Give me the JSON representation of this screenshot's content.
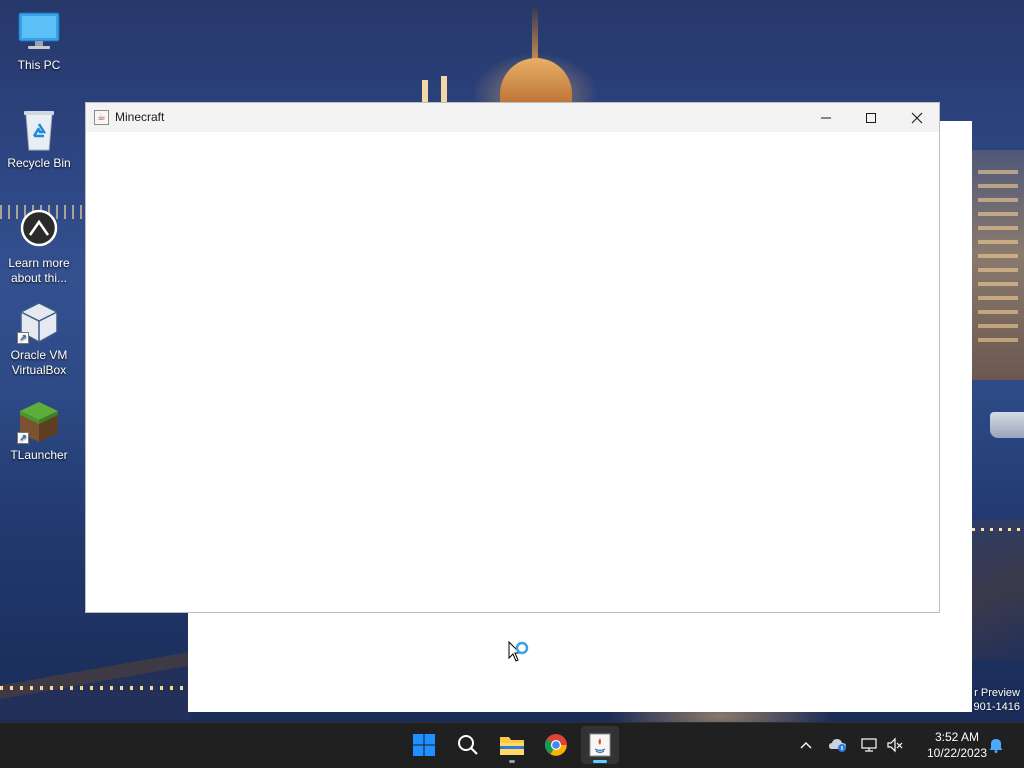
{
  "desktop": {
    "icons": [
      {
        "label": "This PC",
        "icon": "monitor-icon"
      },
      {
        "label": "Recycle Bin",
        "icon": "recycle-bin-icon"
      },
      {
        "label": "Learn more about thi...",
        "icon": "learn-more-icon"
      },
      {
        "label": "Oracle VM VirtualBox",
        "icon": "virtualbox-icon"
      },
      {
        "label": "TLauncher",
        "icon": "minecraft-grass-block-icon"
      }
    ],
    "watermark": {
      "line1": "r Preview",
      "line2": "901-1416"
    }
  },
  "window": {
    "title": "Minecraft",
    "icon": "java-icon",
    "controls": {
      "minimize": "—",
      "maximize": "☐",
      "close": "✕"
    }
  },
  "taskbar": {
    "apps": [
      {
        "name": "Start",
        "icon": "windows-start-icon"
      },
      {
        "name": "Search",
        "icon": "search-icon"
      },
      {
        "name": "File Explorer",
        "icon": "folder-icon"
      },
      {
        "name": "Google Chrome",
        "icon": "chrome-icon"
      },
      {
        "name": "Java",
        "icon": "java-icon"
      }
    ],
    "tray": {
      "icons": [
        "chevron-up-icon",
        "cloud-icon",
        "network-icon",
        "volume-muted-icon",
        "notification-bell-icon"
      ],
      "time": "3:52 AM",
      "date": "10/22/2023"
    }
  },
  "colors": {
    "taskbar_bg": "#202020",
    "start_blue": "#1e90ff",
    "folder_yellow": "#f7c948",
    "accent_indicator": "#60cdff"
  }
}
